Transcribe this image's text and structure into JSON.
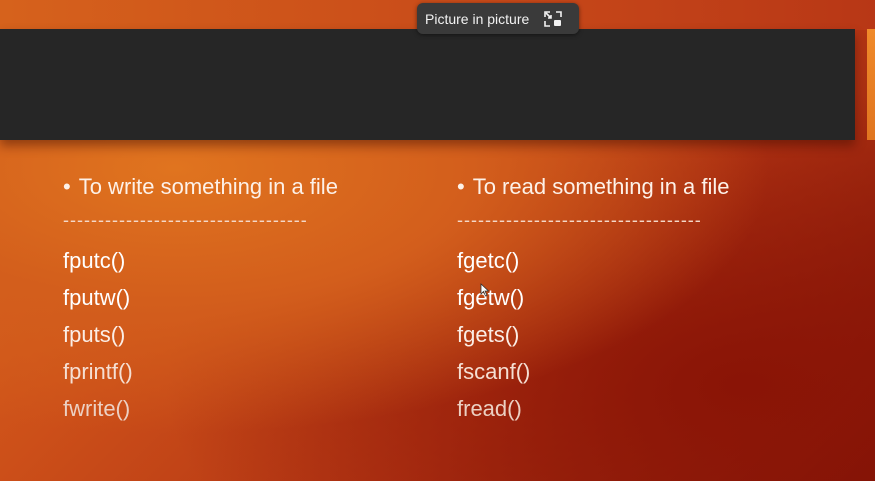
{
  "tooltip": {
    "label": "Picture in picture",
    "icon": "picture-in-picture-icon"
  },
  "slide": {
    "left": {
      "heading": "To write something in a file",
      "separator": "-----------------------------------",
      "functions": [
        "fputc()",
        "fputw()",
        "fputs()",
        "fprintf()",
        "fwrite()"
      ]
    },
    "right": {
      "heading": "To read something in a file",
      "separator": "-----------------------------------",
      "functions": [
        "fgetc()",
        "fgetw()",
        "fgets()",
        "fscanf()",
        "fread()"
      ]
    }
  },
  "colors": {
    "header_bar": "#262626",
    "slide_orange": "#e06c1e",
    "slide_red": "#7d1307",
    "accent": "#f08a2a",
    "tooltip_bg": "#3a3a3a"
  }
}
